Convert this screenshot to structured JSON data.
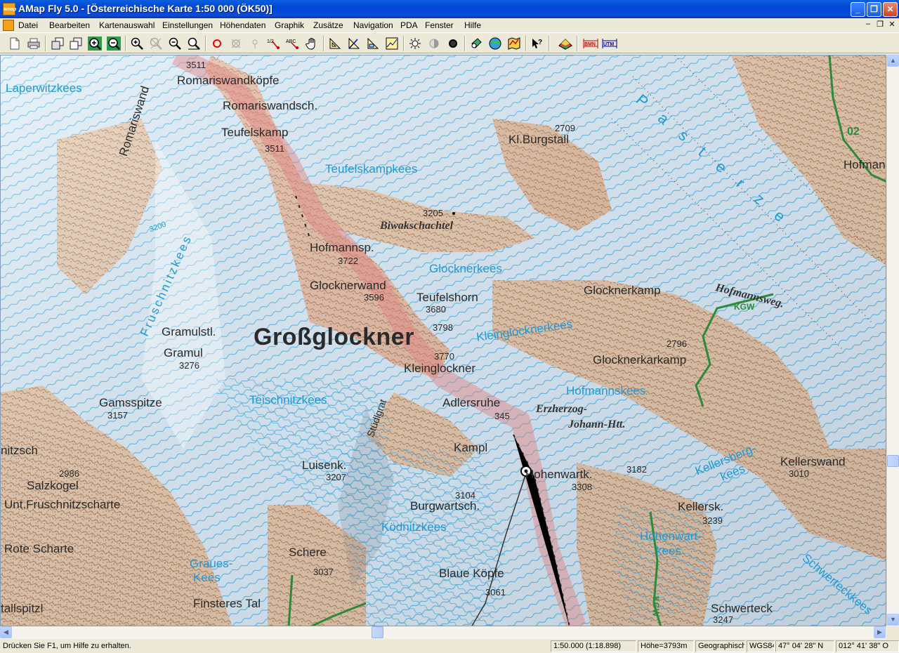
{
  "window": {
    "title": "AMap Fly 5.0 - [Österreichische Karte 1:50 000 (ÖK50)]",
    "app_icon_text": "amap",
    "minimize": "_",
    "maximize": "❐",
    "close": "✕"
  },
  "menu": {
    "items": [
      "Datei",
      "Bearbeiten",
      "Kartenauswahl",
      "Einstellungen",
      "Höhendaten",
      "Graphik",
      "Zusätze",
      "Navigation",
      "PDA",
      "Fenster",
      "Hilfe"
    ],
    "mdi_minimize": "–",
    "mdi_restore": "❐",
    "mdi_close": "✕"
  },
  "toolbar": {
    "buttons": [
      {
        "icon": "new-document-icon"
      },
      {
        "icon": "print-icon"
      },
      {
        "icon": "map-select-icon"
      },
      {
        "icon": "map-copy-icon"
      },
      {
        "icon": "zoom-in-map-icon"
      },
      {
        "icon": "zoom-out-map-icon"
      },
      {
        "icon": "zoom-in-icon"
      },
      {
        "icon": "zoom-disabled-icon"
      },
      {
        "icon": "zoom-out-icon"
      },
      {
        "icon": "zoom-fit-icon"
      },
      {
        "icon": "waypoint-circle-icon"
      },
      {
        "icon": "waypoint-delete-icon"
      },
      {
        "icon": "waypoint-move-icon"
      },
      {
        "icon": "measure-distance-icon"
      },
      {
        "icon": "text-label-icon"
      },
      {
        "icon": "pan-hand-icon"
      },
      {
        "icon": "ruler-triangle-icon"
      },
      {
        "icon": "angle-measure-icon"
      },
      {
        "icon": "area-measure-icon"
      },
      {
        "icon": "profile-icon"
      },
      {
        "icon": "brightness-icon"
      },
      {
        "icon": "contrast-icon"
      },
      {
        "icon": "saturation-icon"
      },
      {
        "icon": "gps-device-icon"
      },
      {
        "icon": "globe-sync-icon"
      },
      {
        "icon": "track-map-icon"
      },
      {
        "icon": "help-cursor-icon"
      },
      {
        "icon": "3d-terrain-icon"
      },
      {
        "icon": "grid-bmn-icon",
        "label": "BMN"
      },
      {
        "icon": "grid-utm-icon",
        "label": "UTM"
      }
    ]
  },
  "map": {
    "peak_labels": [
      {
        "name": "Romariswandköpfe",
        "elev": "3511"
      },
      {
        "name": "Romariswandsch."
      },
      {
        "name": "Teufelskamp",
        "elev": "3511"
      },
      {
        "name": "Kl.Burgstall",
        "elev": "2709"
      },
      {
        "name": "Hofmannsp.",
        "elev": "3722"
      },
      {
        "name": "Glocknerwand",
        "elev": "3596"
      },
      {
        "name": "Teufelshorn",
        "elev": "3680"
      },
      {
        "name": "Gramulstl."
      },
      {
        "name": "Gramul",
        "elev": "3276"
      },
      {
        "name": "Gamsspitze",
        "elev": "3157"
      },
      {
        "name": "Kleinglockner",
        "elev": "3770"
      },
      {
        "name": "Adlersruhe",
        "elev": "345"
      },
      {
        "name": "Kampl"
      },
      {
        "name": "Luisenk.",
        "elev": "3207"
      },
      {
        "name": "Hohenwartk.",
        "elev": "3308"
      },
      {
        "name": "Burgwartsch.",
        "elev": "3104"
      },
      {
        "name": "Glocknerkamp"
      },
      {
        "name": "Glocknerkarkamp",
        "elev": "2796"
      },
      {
        "name": "Kellerswand",
        "elev": "3010"
      },
      {
        "name": "Kellersk.",
        "elev": "3239"
      },
      {
        "name": "Schere",
        "elev": "3037"
      },
      {
        "name": "Blaue Köpfe",
        "elev": "3061"
      },
      {
        "name": "Schwerteck",
        "elev": "3247"
      },
      {
        "name": "Salzkogel",
        "elev": "2986"
      },
      {
        "name": "Unt.Fruschnitzscharte"
      },
      {
        "name": "Rote Scharte"
      },
      {
        "name": "Finsteres Tal"
      },
      {
        "name": "nitzsch"
      },
      {
        "name": "tallspitzl"
      },
      {
        "name": "Romariswand"
      },
      {
        "name": "Hofmann"
      }
    ],
    "summit_name": "Großglockner",
    "summit_elev": "3798",
    "extra_elev": "3182",
    "glacier_labels": [
      {
        "name": "Laperwitzkees"
      },
      {
        "name": "Teufelskampkees"
      },
      {
        "name": "Glocknerkees"
      },
      {
        "name": "Kleinglocknerkees"
      },
      {
        "name": "Hofmannskees"
      },
      {
        "name": "Teischnitzkees"
      },
      {
        "name": "Ködnitzkees"
      },
      {
        "name": "Fruschnitzkees"
      },
      {
        "name": "Pasterze"
      },
      {
        "name": "Graues-"
      },
      {
        "name": "Kees"
      },
      {
        "name": "Kellersberg-"
      },
      {
        "name": "kees"
      },
      {
        "name": "Hohenwart-"
      },
      {
        "name": "kees"
      },
      {
        "name": "Schwerteckkees"
      }
    ],
    "contour_label": "3200",
    "huts": [
      {
        "name": "Biwakschachtel",
        "elev": "3205"
      },
      {
        "name": "Erzherzog-"
      },
      {
        "name": "Johann-Htt."
      },
      {
        "name": "Hofmannsweg."
      }
    ],
    "ridges": [
      {
        "name": "Stüdlgrat"
      }
    ],
    "routes": [
      {
        "name": "KGW"
      },
      {
        "name": "02"
      },
      {
        "name": "KGW"
      }
    ],
    "colors": {
      "glacier": "#dcebf6",
      "rock": "#d9a47c",
      "contour_ice": "#2ea3dc",
      "contour_rock": "#b46a3c",
      "route": "#2e8a3a",
      "boundary": "#e08080"
    }
  },
  "statusbar": {
    "help": "Drücken Sie F1, um Hilfe zu erhalten.",
    "scale": "1:50.000  (1:18.898)",
    "height": "Höhe=3793m",
    "coord_system": "Geographisch",
    "datum": "WGS84",
    "latitude": "47° 04' 28\" N",
    "longitude": "012° 41' 38\" O"
  },
  "scrollbars": {
    "up": "▲",
    "down": "▼",
    "left": "◀",
    "right": "▶"
  }
}
